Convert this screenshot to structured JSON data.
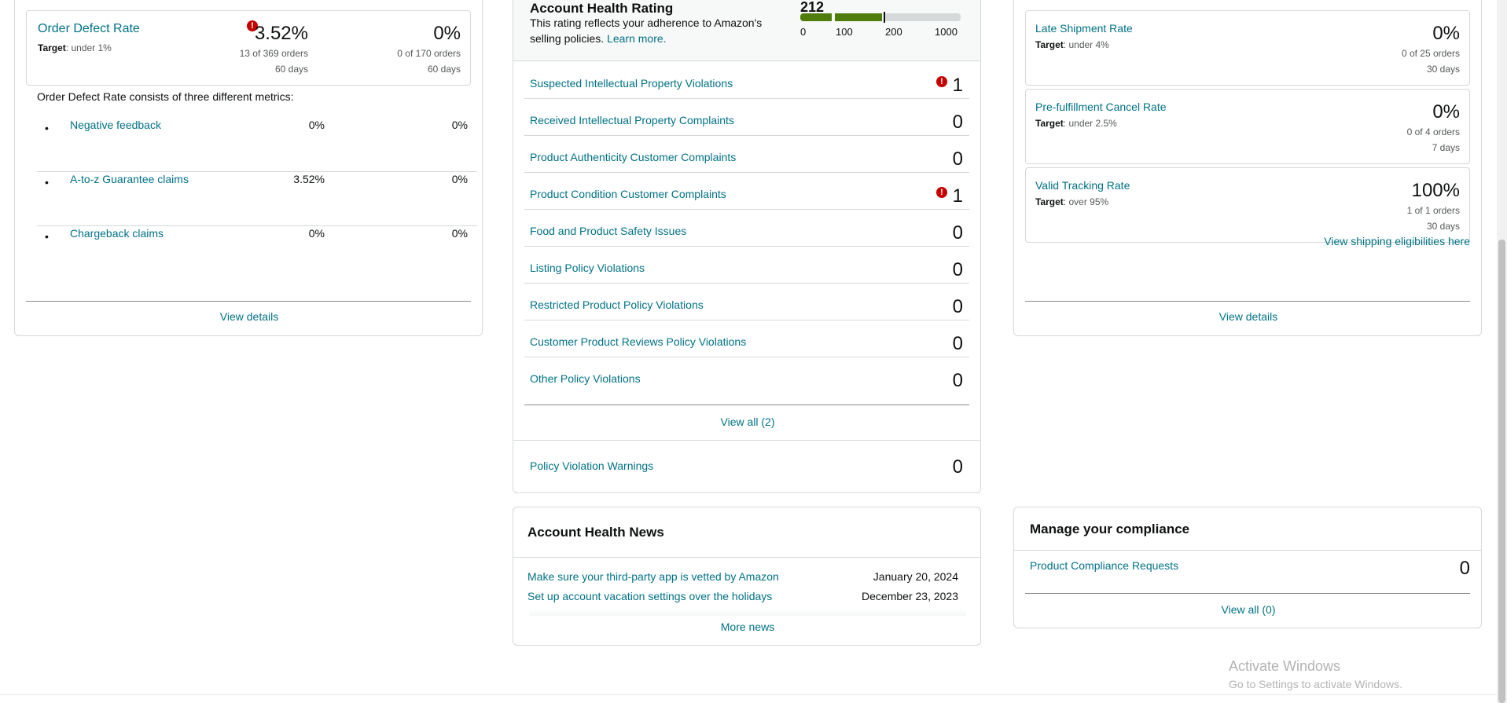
{
  "odr": {
    "title": "Order Defect Rate",
    "target_label": "Target",
    "target_value": ": under 1%",
    "col1": {
      "value": "3.52%",
      "orders": "13 of 369 orders",
      "period": "60 days"
    },
    "col2": {
      "value": "0%",
      "orders": "0 of 170 orders",
      "period": "60 days"
    },
    "consists_text": "Order Defect Rate consists of three different metrics:",
    "metrics": [
      {
        "name": "Negative feedback",
        "v1": "0%",
        "v2": "0%"
      },
      {
        "name": "A-to-z Guarantee claims",
        "v1": "3.52%",
        "v2": "0%"
      },
      {
        "name": "Chargeback claims",
        "v1": "0%",
        "v2": "0%"
      }
    ],
    "view_details": "View details"
  },
  "ahr": {
    "title": "Account Health Rating",
    "score": "212",
    "score_value": 212,
    "desc": "This rating reflects your adherence to Amazon's selling policies.",
    "learn_more": "Learn more.",
    "ticks": [
      "0",
      "100",
      "200",
      "1000"
    ],
    "violations": [
      {
        "name": "Suspected Intellectual Property Violations",
        "count": "1",
        "alert": true
      },
      {
        "name": "Received Intellectual Property Complaints",
        "count": "0",
        "alert": false
      },
      {
        "name": "Product Authenticity Customer Complaints",
        "count": "0",
        "alert": false
      },
      {
        "name": "Product Condition Customer Complaints",
        "count": "1",
        "alert": true
      },
      {
        "name": "Food and Product Safety Issues",
        "count": "0",
        "alert": false
      },
      {
        "name": "Listing Policy Violations",
        "count": "0",
        "alert": false
      },
      {
        "name": "Restricted Product Policy Violations",
        "count": "0",
        "alert": false
      },
      {
        "name": "Customer Product Reviews Policy Violations",
        "count": "0",
        "alert": false
      },
      {
        "name": "Other Policy Violations",
        "count": "0",
        "alert": false
      }
    ],
    "view_all": "View all (2)",
    "pvw": {
      "name": "Policy Violation Warnings",
      "count": "0"
    }
  },
  "news": {
    "title": "Account Health News",
    "items": [
      {
        "title": "Make sure your third-party app is vetted by Amazon",
        "date": "January 20, 2024"
      },
      {
        "title": "Set up account vacation settings over the holidays",
        "date": "December 23, 2023"
      }
    ],
    "more": "More news"
  },
  "shipping": {
    "metrics": [
      {
        "title": "Late Shipment Rate",
        "target_label": "Target",
        "target_value": ": under 4%",
        "value": "0%",
        "orders": "0 of 25 orders",
        "period": "30 days"
      },
      {
        "title": "Pre-fulfillment Cancel Rate",
        "target_label": "Target",
        "target_value": ": under 2.5%",
        "value": "0%",
        "orders": "0 of 4 orders",
        "period": "7 days"
      },
      {
        "title": "Valid Tracking Rate",
        "target_label": "Target",
        "target_value": ": over 95%",
        "value": "100%",
        "orders": "1 of 1 orders",
        "period": "30 days"
      }
    ],
    "eligibilities_link": "View shipping eligibilities here",
    "view_details": "View details"
  },
  "compliance": {
    "title": "Manage your compliance",
    "item": "Product Compliance Requests",
    "count": "0",
    "view_all": "View all (0)"
  },
  "watermark": {
    "line1": "Activate Windows",
    "line2": "Go to Settings to activate Windows."
  },
  "colors": {
    "link": "#007185",
    "alert": "#c40000",
    "health_bar_good": "#507c0a"
  }
}
